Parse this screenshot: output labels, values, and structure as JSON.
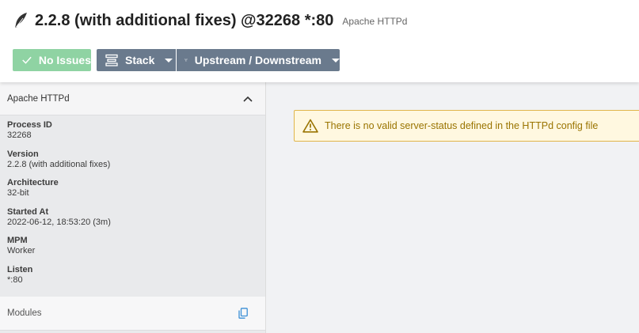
{
  "header": {
    "title": "2.2.8 (with additional fixes) @32268 *:80",
    "subtitle": "Apache HTTPd",
    "icon": "feather-icon"
  },
  "toolbar": {
    "issues_label": "No Issues",
    "stack_label": "Stack",
    "updown_label": "Upstream / Downstream"
  },
  "sidebar": {
    "panel_title": "Apache HTTPd",
    "properties": [
      {
        "label": "Process ID",
        "value": "32268"
      },
      {
        "label": "Version",
        "value": "2.2.8 (with additional fixes)"
      },
      {
        "label": "Architecture",
        "value": "32-bit"
      },
      {
        "label": "Started At",
        "value": "2022-06-12, 18:53:20 (3m)"
      },
      {
        "label": "MPM",
        "value": "Worker"
      },
      {
        "label": "Listen",
        "value": "*:80"
      }
    ],
    "modules_label": "Modules"
  },
  "alert": {
    "text": "There is no valid server-status defined in the HTTPd config file"
  },
  "colors": {
    "success": "#8fd3a3",
    "button": "#6a7a8d",
    "warning_bg": "#fff8e0",
    "warning_border": "#e0b54a",
    "warning_text": "#9a7400",
    "link_blue": "#3b8fd6"
  }
}
